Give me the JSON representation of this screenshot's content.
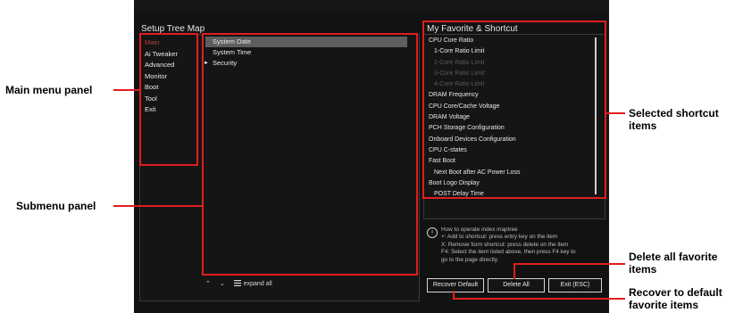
{
  "panels": {
    "tree_title": "Setup Tree Map",
    "favorites_title": "My Favorite & Shortcut"
  },
  "main_menu": {
    "items": [
      "Main",
      "Ai Tweaker",
      "Advanced",
      "Monitor",
      "Boot",
      "Tool",
      "Exit"
    ],
    "selected_index": 0
  },
  "submenu": {
    "items": [
      {
        "label": "System Date",
        "selected": true,
        "has_arrow": false
      },
      {
        "label": "System Time",
        "selected": false,
        "has_arrow": false
      },
      {
        "label": "Security",
        "selected": false,
        "has_arrow": true
      }
    ],
    "arrow_glyph": "►"
  },
  "bottom_controls": {
    "collapse_glyph": "⌃",
    "expand_glyph": "⌄",
    "expand_all_label": "expand all"
  },
  "favorites": {
    "items": [
      {
        "label": "CPU Core Ratio",
        "indent": false,
        "dim": false
      },
      {
        "label": "1-Core Ratio Limit",
        "indent": true,
        "dim": false
      },
      {
        "label": "2-Core Ratio Limit",
        "indent": true,
        "dim": true
      },
      {
        "label": "3-Core Ratio Limit",
        "indent": true,
        "dim": true
      },
      {
        "label": "4-Core Ratio Limit",
        "indent": true,
        "dim": true
      },
      {
        "label": "DRAM Frequency",
        "indent": false,
        "dim": false
      },
      {
        "label": "CPU Core/Cache Voltage",
        "indent": false,
        "dim": false
      },
      {
        "label": "DRAM Voltage",
        "indent": false,
        "dim": false
      },
      {
        "label": "PCH Storage Configuration",
        "indent": false,
        "dim": false
      },
      {
        "label": "Onboard Devices Configuration",
        "indent": false,
        "dim": false
      },
      {
        "label": "CPU C-states",
        "indent": false,
        "dim": false
      },
      {
        "label": "Fast Boot",
        "indent": false,
        "dim": false
      },
      {
        "label": "Next Boot after AC Power Loss",
        "indent": true,
        "dim": false
      },
      {
        "label": "Boot Logo Display",
        "indent": false,
        "dim": false
      },
      {
        "label": "POST Delay Time",
        "indent": true,
        "dim": false
      }
    ]
  },
  "info": {
    "icon_glyph": "i",
    "lines": [
      "How to operate index maptree",
      "+: Add to shortcut: press entry key on the item",
      "X: Remove form shortcut: press delete on the item",
      "F4: Select the item listed above, then press F4 key to",
      "go to the page directly."
    ]
  },
  "buttons": {
    "recover_default": "Recover Default",
    "delete_all": "Delete All",
    "exit": "Exit (ESC)"
  },
  "annotations": {
    "main_menu_panel": "Main menu panel",
    "submenu_panel": "Submenu panel",
    "selected_shortcut_items": [
      "Selected shortcut",
      "items"
    ],
    "delete_all_favorite_items": [
      "Delete all favorite",
      "items"
    ],
    "recover_default_favorite_items": [
      "Recover to default",
      "favorite items"
    ]
  },
  "colors": {
    "annotation_red": "#e11d1d",
    "bios_background": "#121212",
    "selected_menu_text": "#b83d3d",
    "selected_submenu_bg": "#5e5e5e"
  }
}
